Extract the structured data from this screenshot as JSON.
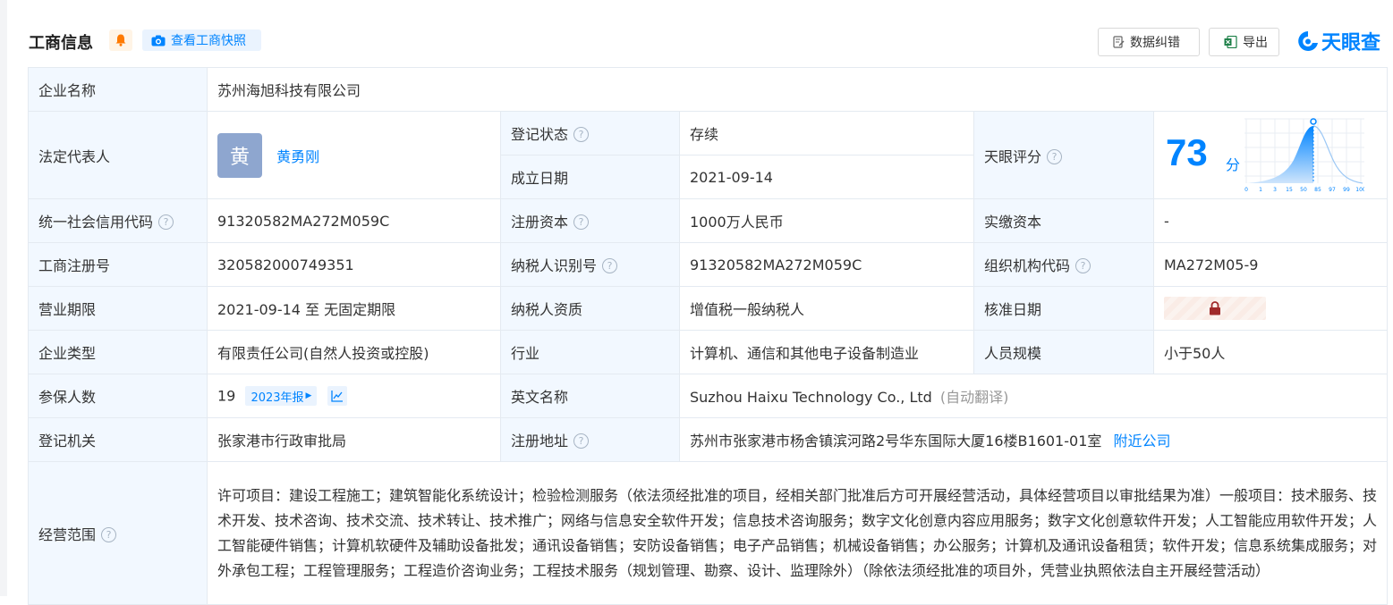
{
  "header": {
    "title": "工商信息",
    "snapshot_label": "查看工商快照",
    "correct_label": "数据纠错",
    "export_label": "导出",
    "logo_text": "天眼查"
  },
  "colors": {
    "accent": "#0084ff",
    "status_green": "#1c9b3e",
    "label_bg": "#f2f8ff",
    "border": "#e4eaf1"
  },
  "info": {
    "company_name_label": "企业名称",
    "company_name": "苏州海旭科技有限公司",
    "legal_rep_label": "法定代表人",
    "legal_rep_avatar": "黄",
    "legal_rep_name": "黄勇刚",
    "status_label": "登记状态",
    "status_value": "存续",
    "founded_label": "成立日期",
    "founded_value": "2021-09-14",
    "score_label": "天眼评分",
    "score_value": "73",
    "score_unit": "分",
    "score_axis": [
      "0",
      "1",
      "3",
      "15",
      "50",
      "85",
      "97",
      "99",
      "100"
    ],
    "credit_code_label": "统一社会信用代码",
    "credit_code_value": "91320582MA272M059C",
    "reg_capital_label": "注册资本",
    "reg_capital_value": "1000万人民币",
    "paid_capital_label": "实缴资本",
    "paid_capital_value": "-",
    "reg_no_label": "工商注册号",
    "reg_no_value": "320582000749351",
    "taxpayer_id_label": "纳税人识别号",
    "taxpayer_id_value": "91320582MA272M059C",
    "org_code_label": "组织机构代码",
    "org_code_value": "MA272M05-9",
    "term_label": "营业期限",
    "term_value": "2021-09-14 至 无固定期限",
    "taxpayer_qual_label": "纳税人资质",
    "taxpayer_qual_value": "增值税一般纳税人",
    "approval_date_label": "核准日期",
    "type_label": "企业类型",
    "type_value": "有限责任公司(自然人投资或控股)",
    "industry_label": "行业",
    "industry_value": "计算机、通信和其他电子设备制造业",
    "staff_label": "人员规模",
    "staff_value": "小于50人",
    "insured_label": "参保人数",
    "insured_value": "19",
    "insured_report": "2023年报",
    "en_name_label": "英文名称",
    "en_name_value": "Suzhou Haixu Technology Co., Ltd",
    "en_name_note": "(自动翻译)",
    "authority_label": "登记机关",
    "authority_value": "张家港市行政审批局",
    "address_label": "注册地址",
    "address_value": "苏州市张家港市杨舍镇滨河路2号华东国际大厦16楼B1601-01室",
    "nearby_label": "附近公司",
    "scope_label": "经营范围",
    "scope_value": "许可项目：建设工程施工；建筑智能化系统设计；检验检测服务（依法须经批准的项目，经相关部门批准后方可开展经营活动，具体经营项目以审批结果为准）一般项目：技术服务、技术开发、技术咨询、技术交流、技术转让、技术推广；网络与信息安全软件开发；信息技术咨询服务；数字文化创意内容应用服务；数字文化创意软件开发；人工智能应用软件开发；人工智能硬件销售；计算机软硬件及辅助设备批发；通讯设备销售；安防设备销售；电子产品销售；机械设备销售；办公服务；计算机及通讯设备租赁；软件开发；信息系统集成服务；对外承包工程；工程管理服务；工程造价咨询业务；工程技术服务（规划管理、勘察、设计、监理除外）（除依法须经批准的项目外，凭营业执照依法自主开展经营活动）"
  }
}
